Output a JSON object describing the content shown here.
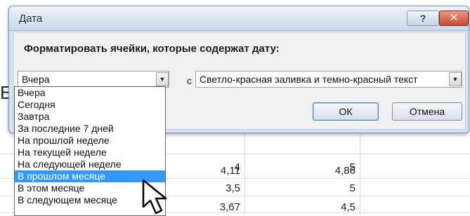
{
  "sheet": {
    "left_edge_glyph": "Б",
    "rows": [
      {
        "col1": "4",
        "col2": "5"
      },
      {
        "col1": "4,11",
        "col2": "4,86"
      },
      {
        "col1": "3,5",
        "col2": "5"
      },
      {
        "col1": "3,67",
        "col2": "4,5"
      }
    ]
  },
  "dialog": {
    "title": "Дата",
    "help_label": "?",
    "close_label": "✕",
    "instruction": "Форматировать ячейки, которые содержат дату:",
    "date_combo": {
      "value": "Вчера",
      "arrow": "▼"
    },
    "connector": "с",
    "format_combo": {
      "value": "Светло-красная заливка и темно-красный текст",
      "arrow": "▼"
    },
    "ok_label": "ОК",
    "cancel_label": "Отмена",
    "dropdown": {
      "items": [
        {
          "label": "Вчера"
        },
        {
          "label": "Сегодня"
        },
        {
          "label": "Завтра"
        },
        {
          "label": "За последние 7 дней"
        },
        {
          "label": "На прошлой неделе"
        },
        {
          "label": "На текущей неделе"
        },
        {
          "label": "На следующей неделе"
        },
        {
          "label": "В прошлом месяце",
          "selected": true
        },
        {
          "label": "В этом месяце"
        },
        {
          "label": "В следующем месяце"
        }
      ]
    }
  },
  "colors": {
    "selection": "#3399ff",
    "titlebar": "#c9d8ec",
    "close_button": "#c64a32"
  }
}
